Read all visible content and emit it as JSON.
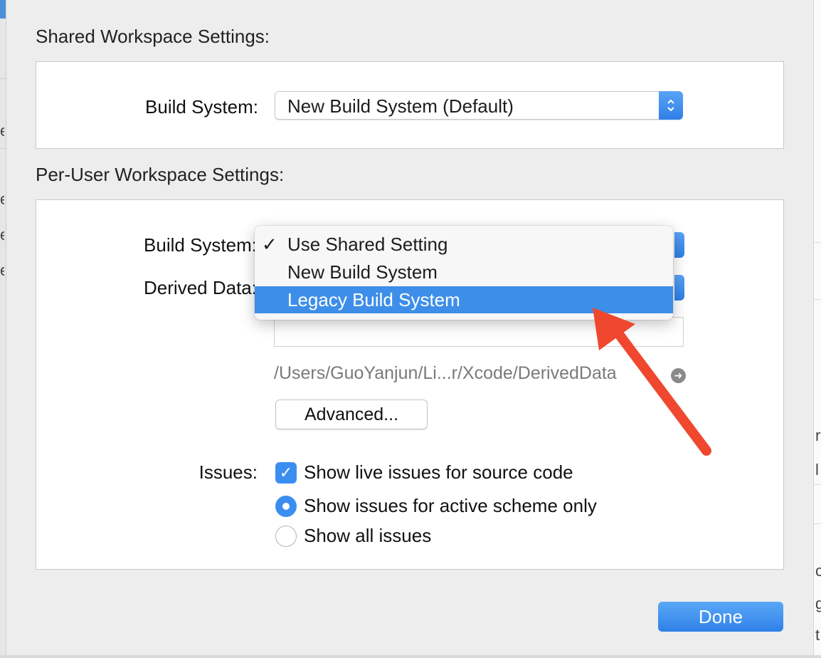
{
  "shared": {
    "title": "Shared Workspace Settings:",
    "build_system_label": "Build System:",
    "build_system_value": "New Build System (Default)"
  },
  "per_user": {
    "title": "Per-User Workspace Settings:",
    "build_system_label": "Build System:",
    "derived_data_label": "Derived Data:",
    "derived_path": "/Users/GuoYanjun/Li...r/Xcode/DerivedData",
    "advanced_button": "Advanced...",
    "issues_label": "Issues:",
    "live_issues_label": "Show live issues for source code",
    "active_scheme_label": "Show issues for active scheme only",
    "all_issues_label": "Show all issues"
  },
  "menu": {
    "items": [
      {
        "label": "Use Shared Setting",
        "checked": true
      },
      {
        "label": "New Build System",
        "checked": false
      },
      {
        "label": "Legacy Build System",
        "checked": false
      }
    ],
    "checkmark": "✓"
  },
  "done_button": "Done",
  "colors": {
    "accent": "#3d8ee9",
    "annotation_arrow": "#f0472f"
  },
  "icons": {
    "stepper": "updown-chevron-icon",
    "path_arrow": "circle-arrow-right-icon",
    "checkbox": "checkmark-icon"
  }
}
